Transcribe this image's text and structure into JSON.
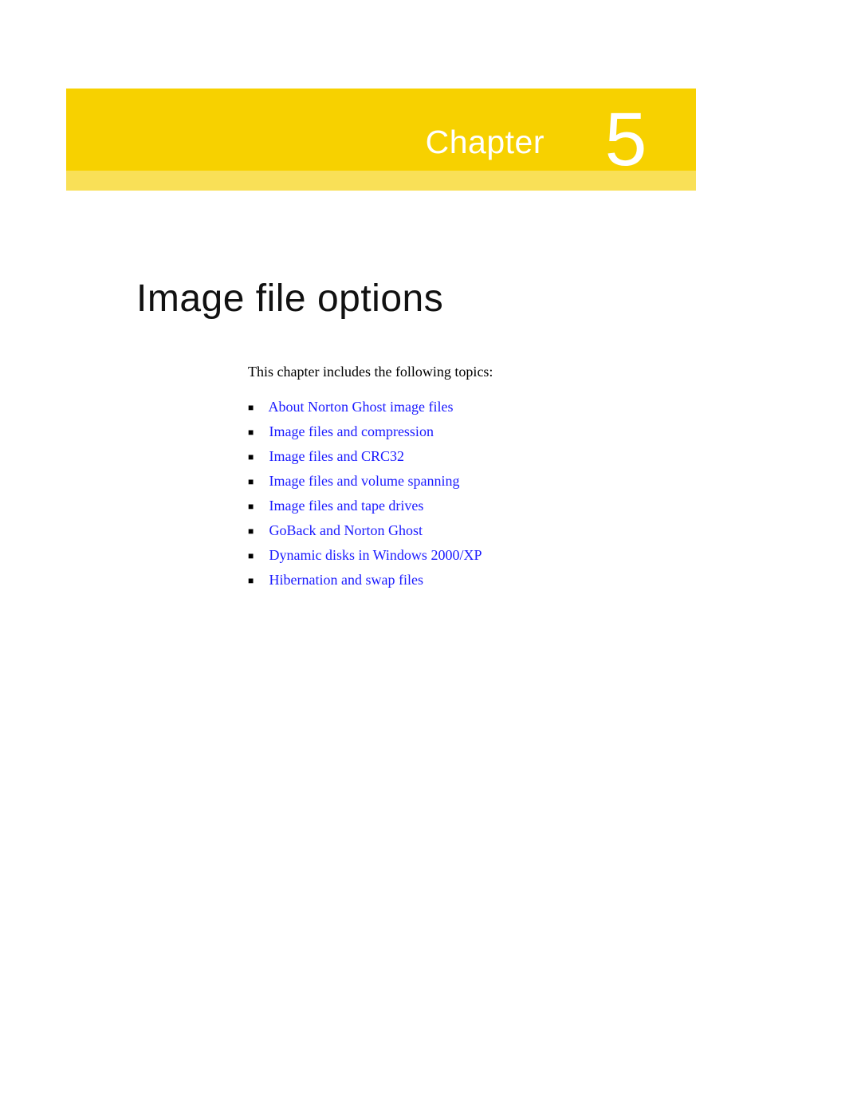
{
  "banner": {
    "label": "Chapter",
    "number": "5"
  },
  "title": "Image file options",
  "intro": "This chapter includes the following topics:",
  "topics": [
    "About Norton Ghost image files",
    "Image files and compression",
    "Image files and CRC32",
    "Image files and volume spanning",
    "Image files and tape drives",
    "GoBack and Norton Ghost",
    "Dynamic disks in Windows 2000/XP",
    "Hibernation and swap files"
  ]
}
